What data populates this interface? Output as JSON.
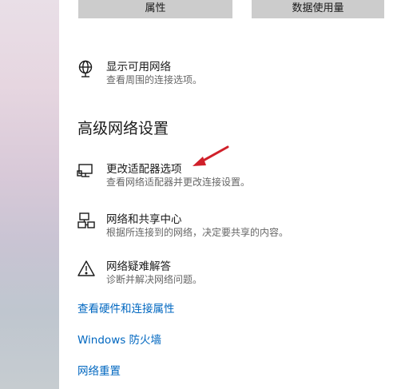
{
  "top_buttons": {
    "properties": "属性",
    "data_usage": "数据使用量"
  },
  "show_networks": {
    "title": "显示可用网络",
    "desc": "查看周围的连接选项。",
    "icon": "globe-icon"
  },
  "advanced_heading": "高级网络设置",
  "advanced_items": [
    {
      "title": "更改适配器选项",
      "desc": "查看网络适配器并更改连接设置。",
      "icon": "network-adapter-icon"
    },
    {
      "title": "网络和共享中心",
      "desc": "根据所连接到的网络，决定要共享的内容。",
      "icon": "network-sharing-icon"
    },
    {
      "title": "网络疑难解答",
      "desc": "诊断并解决网络问题。",
      "icon": "warning-icon"
    }
  ],
  "links": {
    "hardware": "查看硬件和连接属性",
    "firewall": "Windows 防火墙",
    "reset": "网络重置"
  },
  "colors": {
    "link": "#0067c0",
    "annotation_arrow": "#d0202a",
    "button_bg": "#cccccc"
  }
}
